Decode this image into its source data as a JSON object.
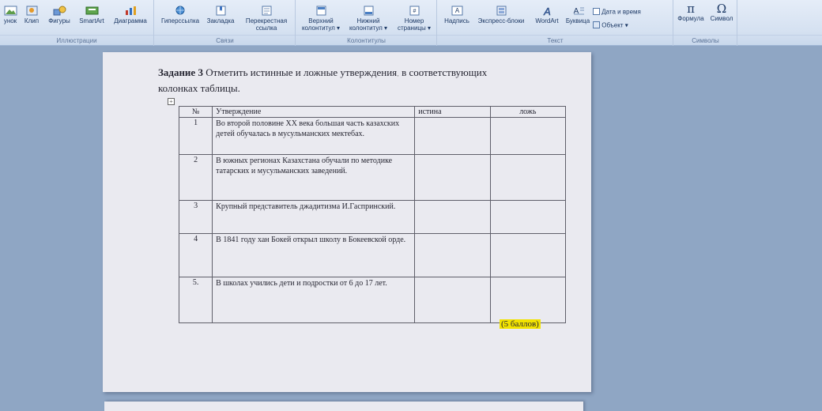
{
  "ribbon": {
    "illustrations": {
      "group_label": "Иллюстрации",
      "buttons": [
        "унок",
        "Клип",
        "Фигуры",
        "SmartArt",
        "Диаграмма"
      ]
    },
    "links": {
      "group_label": "Связи",
      "hyperlink": "Гиперссылка",
      "bookmark": "Закладка",
      "crossref_1": "Перекрестная",
      "crossref_2": "ссылка"
    },
    "header_footer": {
      "group_label": "Колонтитулы",
      "header_1": "Верхний",
      "header_2": "колонтитул ▾",
      "footer_1": "Нижний",
      "footer_2": "колонтитул ▾",
      "pagenum_1": "Номер",
      "pagenum_2": "страницы ▾"
    },
    "text": {
      "group_label": "Текст",
      "textbox": "Надпись",
      "quickparts": "Экспресс-блоки",
      "wordart": "WordArt",
      "dropcap": "Буквица",
      "datetime": "Дата и время",
      "object": "Объект ▾"
    },
    "symbols": {
      "group_label": "Символы",
      "formula": "Формула",
      "symbol": "Символ"
    }
  },
  "document": {
    "task_title": "Задание 3",
    "task_text_1": "Отметить  истинные  и ложные утверждения",
    "task_text_2": "в соответствующих",
    "task_text_3": "колонках таблицы.",
    "table": {
      "headers": [
        "№",
        "Утверждение",
        "истина",
        "ложь"
      ],
      "rows": [
        {
          "num": "1",
          "statement": "Во второй половине XX  века большая часть казахских детей  обучалась в мусульманских мектебах."
        },
        {
          "num": "2",
          "statement": "В южных регионах Казахстана обучали по методике татарских  и мусульманских заведений."
        },
        {
          "num": "3",
          "statement": "Крупный представитель джадитизма И.Гаспринский."
        },
        {
          "num": "4",
          "statement": "В 1841 году хан Бокей открыл  школу в Бокеевской орде."
        },
        {
          "num": "5.",
          "statement": "В школах учились дети  и подростки от 6 до 17 лет."
        }
      ]
    },
    "points": "(5 баллов)"
  }
}
